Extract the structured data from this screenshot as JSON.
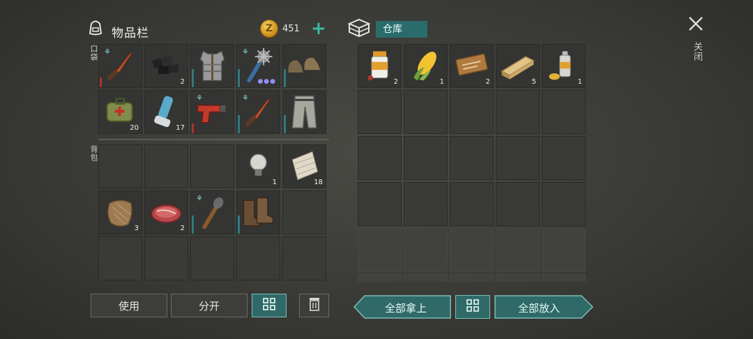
{
  "inventory": {
    "title": "物品栏",
    "coins": "451",
    "pocket_label": "口袋",
    "backpack_label": "背包",
    "pocket_slots": [
      {
        "icon": "knife-icon",
        "count": "",
        "dur": "#b0332b",
        "tree": true
      },
      {
        "icon": "coal-icon",
        "count": "2",
        "dur": "",
        "tree": false
      },
      {
        "icon": "armor-vest-icon",
        "count": "",
        "dur": "#2f7a80",
        "tree": false
      },
      {
        "icon": "spiked-club-icon",
        "count": "",
        "dur": "#2f7a80",
        "tree": true,
        "dots": "●●●"
      },
      {
        "icon": "shoes-icon",
        "count": "",
        "dur": "#2f7a80",
        "tree": false
      },
      {
        "icon": "medkit-bag-icon",
        "count": "20",
        "dur": "",
        "tree": false
      },
      {
        "icon": "inhaler-icon",
        "count": "17",
        "dur": "",
        "tree": false
      },
      {
        "icon": "flare-gun-icon",
        "count": "",
        "dur": "#b0332b",
        "tree": true
      },
      {
        "icon": "knife-icon",
        "count": "",
        "dur": "#2f7a80",
        "tree": true
      },
      {
        "icon": "pants-icon",
        "count": "",
        "dur": "#2f7a80",
        "tree": false
      }
    ],
    "backpack_slots": [
      {
        "icon": "",
        "count": "",
        "dur": "",
        "tree": false
      },
      {
        "icon": "",
        "count": "",
        "dur": "",
        "tree": false
      },
      {
        "icon": "",
        "count": "",
        "dur": "",
        "tree": false
      },
      {
        "icon": "light-bulb-icon",
        "count": "1",
        "dur": "",
        "tree": false
      },
      {
        "icon": "fabric-icon",
        "count": "18",
        "dur": "",
        "tree": false
      },
      {
        "icon": "fur-icon",
        "count": "3",
        "dur": "",
        "tree": false
      },
      {
        "icon": "raw-meat-icon",
        "count": "2",
        "dur": "",
        "tree": false
      },
      {
        "icon": "torch-icon",
        "count": "",
        "dur": "#2f7a80",
        "tree": true
      },
      {
        "icon": "boots-icon",
        "count": "",
        "dur": "#2f7a80",
        "tree": false
      },
      {
        "icon": "",
        "count": "",
        "dur": "",
        "tree": false
      },
      {
        "icon": "",
        "count": "",
        "dur": "",
        "tree": false
      },
      {
        "icon": "",
        "count": "",
        "dur": "",
        "tree": false
      },
      {
        "icon": "",
        "count": "",
        "dur": "",
        "tree": false
      },
      {
        "icon": "",
        "count": "",
        "dur": "",
        "tree": false
      },
      {
        "icon": "",
        "count": "",
        "dur": "",
        "tree": false
      }
    ],
    "buttons": {
      "use": "使用",
      "split": "分开",
      "sort_icon": "grid-sort-icon",
      "trash_icon": "trash-icon"
    }
  },
  "warehouse": {
    "title": "仓库",
    "icon": "storage-box-icon",
    "row1": [
      {
        "icon": "pill-bottle-icon",
        "count": "2"
      },
      {
        "icon": "corn-icon",
        "count": "1"
      },
      {
        "icon": "coupon-icon",
        "count": "2"
      },
      {
        "icon": "wood-plank-icon",
        "count": "5"
      },
      {
        "icon": "spray-can-icon",
        "count": "1"
      }
    ],
    "buttons": {
      "take_all": "全部拿上",
      "put_all": "全部放入",
      "sort_icon": "grid-sort-icon"
    }
  },
  "close": {
    "label": "关闭",
    "icon": "close-icon"
  },
  "colors": {
    "teal": "#2f6a68",
    "durability_red": "#b0332b",
    "durability_teal": "#2f7a80"
  }
}
